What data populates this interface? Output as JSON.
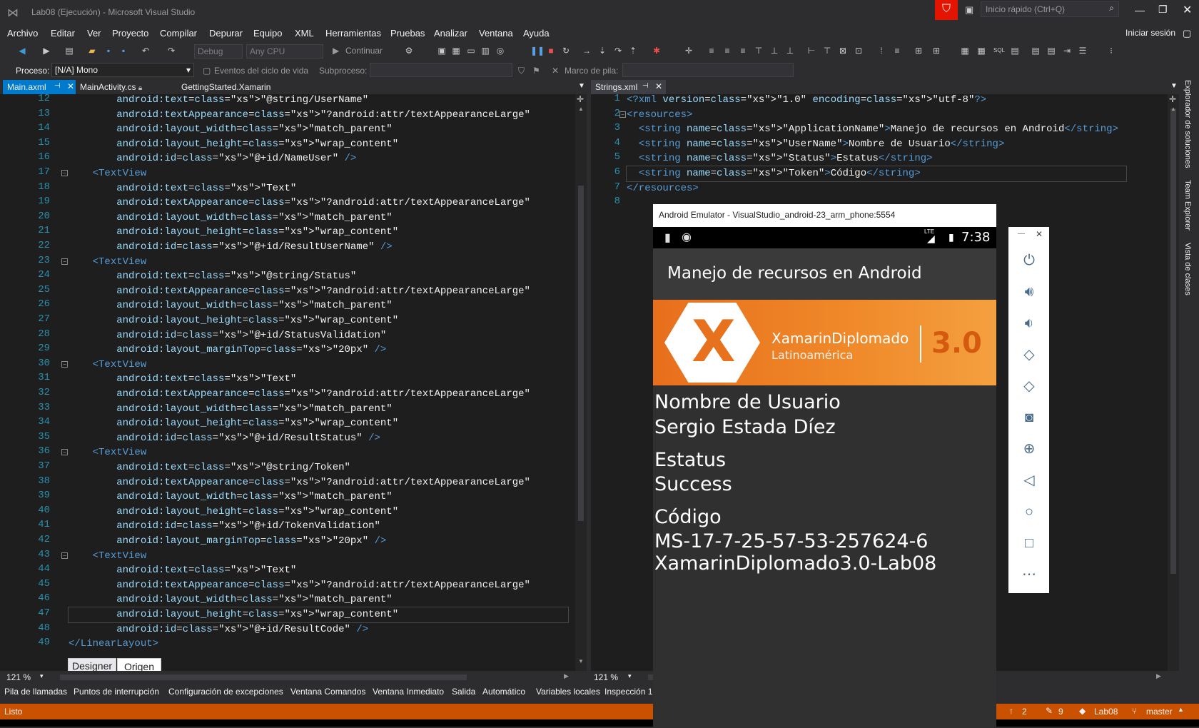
{
  "window": {
    "title": "Lab08 (Ejecución) - Microsoft Visual Studio",
    "quick_launch": "Inicio rápido (Ctrl+Q)",
    "signin": "Iniciar sesión"
  },
  "menu": [
    "Archivo",
    "Editar",
    "Ver",
    "Proyecto",
    "Compilar",
    "Depurar",
    "Equipo",
    "XML",
    "Herramientas",
    "Pruebas",
    "Analizar",
    "Ventana",
    "Ayuda"
  ],
  "toolbar": {
    "config": "Debug",
    "platform": "Any CPU",
    "continue": "Continuar",
    "process_label": "Proceso:",
    "process_value": "[N/A] Mono",
    "lifecycle": "Eventos del ciclo de vida",
    "thread": "Subproceso:",
    "stack": "Marco de pila:"
  },
  "tabs_left": [
    {
      "label": "Main.axml",
      "active": true
    },
    {
      "label": "MainActivity.cs"
    },
    {
      "label": "GettingStarted.Xamarin"
    }
  ],
  "tabs_right": [
    {
      "label": "Strings.xml"
    }
  ],
  "left_editor": {
    "zoom": "121 %",
    "designer_tab": "Designer",
    "source_tab": "Origen",
    "lines": [
      {
        "n": "12",
        "t": "        android:text=\"@string/UserName\""
      },
      {
        "n": "13",
        "t": "        android:textAppearance=\"?android:attr/textAppearanceLarge\""
      },
      {
        "n": "14",
        "t": "        android:layout_width=\"match_parent\""
      },
      {
        "n": "15",
        "t": "        android:layout_height=\"wrap_content\""
      },
      {
        "n": "16",
        "t": "        android:id=\"@+id/NameUser\" />"
      },
      {
        "n": "17",
        "t": "    <TextView"
      },
      {
        "n": "18",
        "t": "        android:text=\"Text\""
      },
      {
        "n": "19",
        "t": "        android:textAppearance=\"?android:attr/textAppearanceLarge\""
      },
      {
        "n": "20",
        "t": "        android:layout_width=\"match_parent\""
      },
      {
        "n": "21",
        "t": "        android:layout_height=\"wrap_content\""
      },
      {
        "n": "22",
        "t": "        android:id=\"@+id/ResultUserName\" />"
      },
      {
        "n": "23",
        "t": "    <TextView"
      },
      {
        "n": "24",
        "t": "        android:text=\"@string/Status\""
      },
      {
        "n": "25",
        "t": "        android:textAppearance=\"?android:attr/textAppearanceLarge\""
      },
      {
        "n": "26",
        "t": "        android:layout_width=\"match_parent\""
      },
      {
        "n": "27",
        "t": "        android:layout_height=\"wrap_content\""
      },
      {
        "n": "28",
        "t": "        android:id=\"@+id/StatusValidation\""
      },
      {
        "n": "29",
        "t": "        android:layout_marginTop=\"20px\" />"
      },
      {
        "n": "30",
        "t": "    <TextView"
      },
      {
        "n": "31",
        "t": "        android:text=\"Text\""
      },
      {
        "n": "32",
        "t": "        android:textAppearance=\"?android:attr/textAppearanceLarge\""
      },
      {
        "n": "33",
        "t": "        android:layout_width=\"match_parent\""
      },
      {
        "n": "34",
        "t": "        android:layout_height=\"wrap_content\""
      },
      {
        "n": "35",
        "t": "        android:id=\"@+id/ResultStatus\" />"
      },
      {
        "n": "36",
        "t": "    <TextView"
      },
      {
        "n": "37",
        "t": "        android:text=\"@string/Token\""
      },
      {
        "n": "38",
        "t": "        android:textAppearance=\"?android:attr/textAppearanceLarge\""
      },
      {
        "n": "39",
        "t": "        android:layout_width=\"match_parent\""
      },
      {
        "n": "40",
        "t": "        android:layout_height=\"wrap_content\""
      },
      {
        "n": "41",
        "t": "        android:id=\"@+id/TokenValidation\""
      },
      {
        "n": "42",
        "t": "        android:layout_marginTop=\"20px\" />"
      },
      {
        "n": "43",
        "t": "    <TextView"
      },
      {
        "n": "44",
        "t": "        android:text=\"Text\""
      },
      {
        "n": "45",
        "t": "        android:textAppearance=\"?android:attr/textAppearanceLarge\""
      },
      {
        "n": "46",
        "t": "        android:layout_width=\"match_parent\""
      },
      {
        "n": "47",
        "t": "        android:layout_height=\"wrap_content\""
      },
      {
        "n": "48",
        "t": "        android:id=\"@+id/ResultCode\" />"
      },
      {
        "n": "49",
        "t": "</LinearLayout>"
      }
    ]
  },
  "right_editor": {
    "zoom": "121 %",
    "lines": [
      {
        "n": "1",
        "t": "<?xml version=\"1.0\" encoding=\"utf-8\"?>"
      },
      {
        "n": "2",
        "t": "<resources>"
      },
      {
        "n": "3",
        "t": "  <string name=\"ApplicationName\">Manejo de recursos en Android</string>"
      },
      {
        "n": "4",
        "t": "  <string name=\"UserName\">Nombre de Usuario</string>"
      },
      {
        "n": "5",
        "t": "  <string name=\"Status\">Estatus</string>"
      },
      {
        "n": "6",
        "t": "  <string name=\"Token\">Código</string>"
      },
      {
        "n": "7",
        "t": "</resources>"
      },
      {
        "n": "8",
        "t": ""
      }
    ]
  },
  "emulator": {
    "title": "Android Emulator - VisualStudio_android-23_arm_phone:5554",
    "network": "LTE",
    "time": "7:38",
    "app_title": "Manejo de recursos en Android",
    "banner_brand": "XamarinDiplomado",
    "banner_sub": "Latinoamérica",
    "banner_version": "3.0",
    "texts": [
      "Nombre de Usuario",
      "Sergio Estada Díez",
      "Estatus",
      "Success",
      "Código",
      "MS-17-7-25-57-53-257624-6",
      "XamarinDiplomado3.0-Lab08"
    ]
  },
  "side_rail": [
    "Explorador de soluciones",
    "Team Explorer",
    "Vista de clases"
  ],
  "bottom_tabs": [
    "Pila de llamadas",
    "Puntos de interrupción",
    "Configuración de excepciones",
    "Ventana Comandos",
    "Ventana Inmediato",
    "Salida",
    "Automático",
    "Variables locales",
    "Inspección 1"
  ],
  "status": {
    "left": "Listo",
    "up": "2",
    "edits": "9",
    "repo": "Lab08",
    "branch": "master"
  }
}
